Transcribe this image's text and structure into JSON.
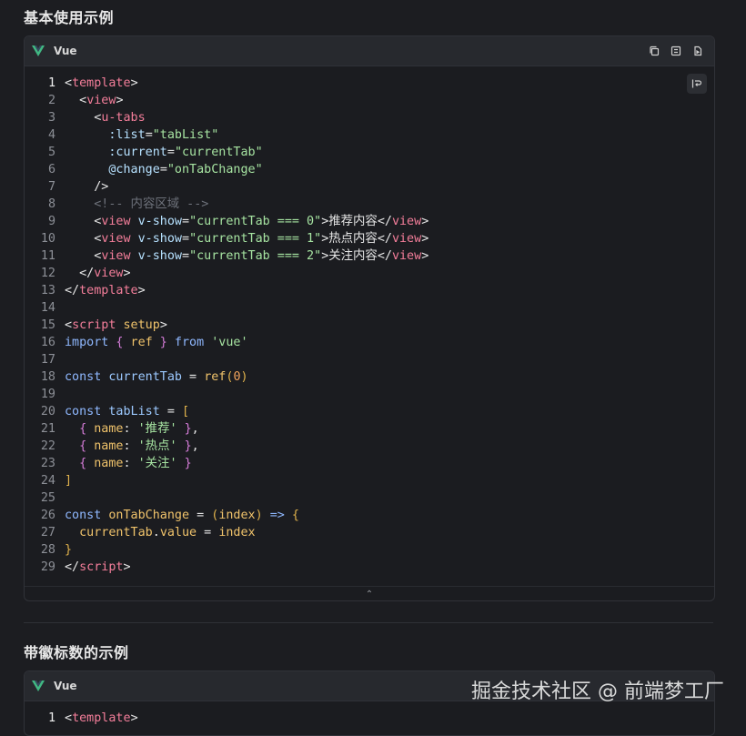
{
  "sections": [
    {
      "title": "基本使用示例"
    },
    {
      "title": "带徽标数的示例"
    }
  ],
  "code_block_1": {
    "language": "Vue",
    "lines": [
      [
        [
          "t-punc",
          "<"
        ],
        [
          "t-tag",
          "template"
        ],
        [
          "t-punc",
          ">"
        ]
      ],
      [
        [
          "t-punc",
          "  <"
        ],
        [
          "t-tag",
          "view"
        ],
        [
          "t-punc",
          ">"
        ]
      ],
      [
        [
          "t-punc",
          "    <"
        ],
        [
          "t-tag",
          "u-tabs"
        ]
      ],
      [
        [
          "t-attr",
          "      :list"
        ],
        [
          "t-punc",
          "="
        ],
        [
          "t-str",
          "\"tabList\""
        ]
      ],
      [
        [
          "t-attr",
          "      :current"
        ],
        [
          "t-punc",
          "="
        ],
        [
          "t-str",
          "\"currentTab\""
        ]
      ],
      [
        [
          "t-attr",
          "      @change"
        ],
        [
          "t-punc",
          "="
        ],
        [
          "t-str",
          "\"onTabChange\""
        ]
      ],
      [
        [
          "t-punc",
          "    />"
        ]
      ],
      [
        [
          "t-comment",
          "    <!-- 内容区域 -->"
        ]
      ],
      [
        [
          "t-punc",
          "    <"
        ],
        [
          "t-tag",
          "view"
        ],
        [
          "t-attr",
          " v-show"
        ],
        [
          "t-punc",
          "="
        ],
        [
          "t-str",
          "\"currentTab === 0\""
        ],
        [
          "t-punc",
          ">"
        ],
        [
          "t-text",
          "推荐内容"
        ],
        [
          "t-punc",
          "</"
        ],
        [
          "t-tag",
          "view"
        ],
        [
          "t-punc",
          ">"
        ]
      ],
      [
        [
          "t-punc",
          "    <"
        ],
        [
          "t-tag",
          "view"
        ],
        [
          "t-attr",
          " v-show"
        ],
        [
          "t-punc",
          "="
        ],
        [
          "t-str",
          "\"currentTab === 1\""
        ],
        [
          "t-punc",
          ">"
        ],
        [
          "t-text",
          "热点内容"
        ],
        [
          "t-punc",
          "</"
        ],
        [
          "t-tag",
          "view"
        ],
        [
          "t-punc",
          ">"
        ]
      ],
      [
        [
          "t-punc",
          "    <"
        ],
        [
          "t-tag",
          "view"
        ],
        [
          "t-attr",
          " v-show"
        ],
        [
          "t-punc",
          "="
        ],
        [
          "t-str",
          "\"currentTab === 2\""
        ],
        [
          "t-punc",
          ">"
        ],
        [
          "t-text",
          "关注内容"
        ],
        [
          "t-punc",
          "</"
        ],
        [
          "t-tag",
          "view"
        ],
        [
          "t-punc",
          ">"
        ]
      ],
      [
        [
          "t-punc",
          "  </"
        ],
        [
          "t-tag",
          "view"
        ],
        [
          "t-punc",
          ">"
        ]
      ],
      [
        [
          "t-punc",
          "</"
        ],
        [
          "t-tag",
          "template"
        ],
        [
          "t-punc",
          ">"
        ]
      ],
      [],
      [
        [
          "t-punc",
          "<"
        ],
        [
          "t-tag",
          "script"
        ],
        [
          "t-fn",
          " setup"
        ],
        [
          "t-punc",
          ">"
        ]
      ],
      [
        [
          "t-kw",
          "import"
        ],
        [
          "t-brace2",
          " {"
        ],
        [
          "t-fn",
          " ref"
        ],
        [
          "t-brace2",
          " }"
        ],
        [
          "t-kw",
          " from"
        ],
        [
          "t-str",
          " 'vue'"
        ]
      ],
      [],
      [
        [
          "t-kw",
          "const"
        ],
        [
          "t-var",
          " currentTab"
        ],
        [
          "t-punc",
          " = "
        ],
        [
          "t-fn",
          "ref"
        ],
        [
          "t-brace",
          "("
        ],
        [
          "t-num",
          "0"
        ],
        [
          "t-brace",
          ")"
        ]
      ],
      [],
      [
        [
          "t-kw",
          "const"
        ],
        [
          "t-var",
          " tabList"
        ],
        [
          "t-punc",
          " = "
        ],
        [
          "t-brace",
          "["
        ]
      ],
      [
        [
          "t-brace2",
          "  {"
        ],
        [
          "t-fn",
          " name"
        ],
        [
          "t-punc",
          ": "
        ],
        [
          "t-str",
          "'推荐'"
        ],
        [
          "t-brace2",
          " }"
        ],
        [
          "t-punc",
          ","
        ]
      ],
      [
        [
          "t-brace2",
          "  {"
        ],
        [
          "t-fn",
          " name"
        ],
        [
          "t-punc",
          ": "
        ],
        [
          "t-str",
          "'热点'"
        ],
        [
          "t-brace2",
          " }"
        ],
        [
          "t-punc",
          ","
        ]
      ],
      [
        [
          "t-brace2",
          "  {"
        ],
        [
          "t-fn",
          " name"
        ],
        [
          "t-punc",
          ": "
        ],
        [
          "t-str",
          "'关注'"
        ],
        [
          "t-brace2",
          " }"
        ]
      ],
      [
        [
          "t-brace",
          "]"
        ]
      ],
      [],
      [
        [
          "t-kw",
          "const"
        ],
        [
          "t-fn",
          " onTabChange"
        ],
        [
          "t-punc",
          " = "
        ],
        [
          "t-brace",
          "("
        ],
        [
          "t-fn",
          "index"
        ],
        [
          "t-brace",
          ")"
        ],
        [
          "t-kw",
          " =>"
        ],
        [
          "t-brace",
          " {"
        ]
      ],
      [
        [
          "t-fn",
          "  currentTab"
        ],
        [
          "t-punc",
          "."
        ],
        [
          "t-fn",
          "value"
        ],
        [
          "t-punc",
          " = "
        ],
        [
          "t-fn",
          "index"
        ]
      ],
      [
        [
          "t-brace",
          "}"
        ]
      ],
      [
        [
          "t-punc",
          "</"
        ],
        [
          "t-tag",
          "script"
        ],
        [
          "t-punc",
          ">"
        ]
      ]
    ],
    "active_line": 1
  },
  "code_block_2": {
    "language": "Vue",
    "lines": [
      [
        [
          "t-punc",
          "<"
        ],
        [
          "t-tag",
          "template"
        ],
        [
          "t-punc",
          ">"
        ]
      ]
    ],
    "active_line": 1
  },
  "watermark": "掘金技术社区 @ 前端梦工厂",
  "collapse_glyph": "⌃"
}
